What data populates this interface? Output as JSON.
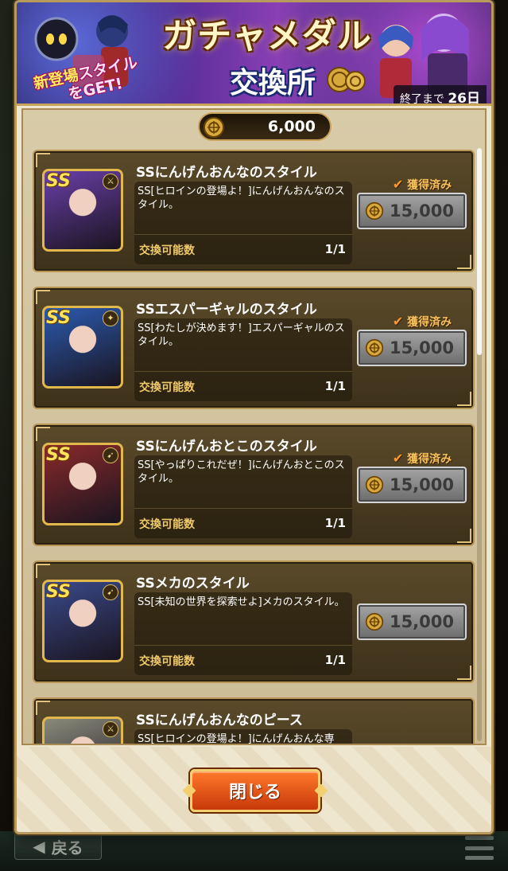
{
  "banner": {
    "title": "ガチャメダル",
    "subtitle": "交換所",
    "tagline_line1_pre": "新登場",
    "tagline_line1_post": "スタイル",
    "tagline_line2": "をGET!",
    "deadline_prefix": "終了まで",
    "deadline_days": "26日"
  },
  "balance": {
    "amount": "6,000"
  },
  "items": [
    {
      "title": "SSにんげんおんなのスタイル",
      "description": "SS[ヒロインの登場よ！]にんげんおんなのスタイル。",
      "exchange_label": "交換可能数",
      "exchange_count": "1/1",
      "acquired_label": "獲得済み",
      "price": "15,000",
      "rank": "SS",
      "portrait_color": "#6a3fa8",
      "weapon_icon": "sword-icon"
    },
    {
      "title": "SSエスパーギャルのスタイル",
      "description": "SS[わたしが決めます！]エスパーギャルのスタイル。",
      "exchange_label": "交換可能数",
      "exchange_count": "1/1",
      "acquired_label": "獲得済み",
      "price": "15,000",
      "rank": "SS",
      "portrait_color": "#2b5bb0",
      "weapon_icon": "staff-icon"
    },
    {
      "title": "SSにんげんおとこのスタイル",
      "description": "SS[やっぱりこれだぜ！]にんげんおとこのスタイル。",
      "exchange_label": "交換可能数",
      "exchange_count": "1/1",
      "acquired_label": "獲得済み",
      "price": "15,000",
      "rank": "SS",
      "portrait_color": "#8a2a2a",
      "weapon_icon": "gun-icon"
    },
    {
      "title": "SSメカのスタイル",
      "description": "SS[未知の世界を探索せよ]メカのスタイル。",
      "exchange_label": "交換可能数",
      "exchange_count": "1/1",
      "acquired_label": "",
      "price": "15,000",
      "rank": "SS",
      "portrait_color": "#3a4a8a",
      "weapon_icon": "gun-icon"
    },
    {
      "title": "SSにんげんおんなのピース",
      "description": "SS[ヒロインの登場よ！]にんげんおんな専",
      "exchange_label": "",
      "exchange_count": "",
      "acquired_label": "",
      "price": "",
      "rank": "",
      "portrait_color": "#8a8a7a",
      "weapon_icon": "sword-icon"
    }
  ],
  "footer": {
    "close_label": "閉じる"
  },
  "background": {
    "back_label": "戻る"
  },
  "colors": {
    "accent_gold": "#b69452",
    "acquired_orange": "#f6c05a",
    "close_button": "#e0561a"
  }
}
